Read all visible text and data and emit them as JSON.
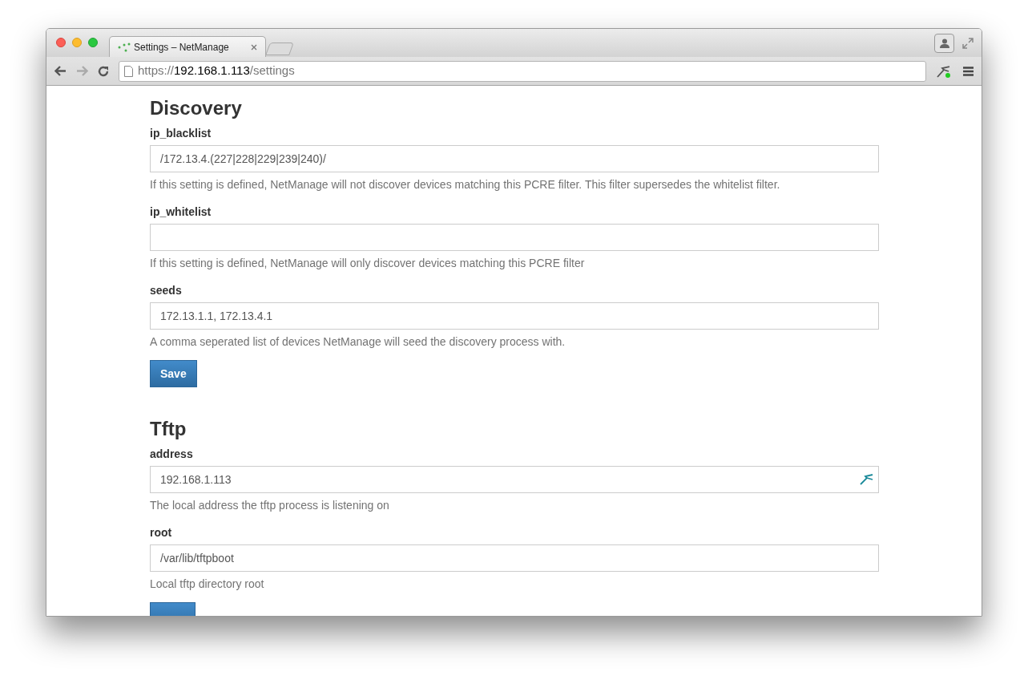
{
  "browser": {
    "tab": {
      "title": "Settings – NetManage",
      "selected": true
    },
    "address": {
      "scheme": "https://",
      "host": "192.168.1.113",
      "path": "/settings"
    }
  },
  "sections": [
    {
      "title": "Discovery",
      "fields": [
        {
          "kind": "plain",
          "label": "ip_blacklist",
          "value": "/172.13.4.(227|228|229|239|240)/",
          "help": "If this setting is defined, NetManage will not discover devices matching this PCRE filter. This filter supersedes the whitelist filter."
        },
        {
          "kind": "plain",
          "label": "ip_whitelist",
          "help": "If this setting is defined, NetManage will only discover devices matching this PCRE filter"
        },
        {
          "kind": "plain",
          "label": "seeds",
          "value": "172.13.1.1, 172.13.4.1",
          "help": "A comma seperated list of devices NetManage will seed the discovery process with."
        }
      ],
      "button": {
        "kind": "full",
        "label": "Save"
      }
    },
    {
      "title": "Tftp",
      "fields": [
        {
          "kind": "with_icon",
          "label": "address",
          "value": "192.168.1.113",
          "help": "The local address the tftp process is listening on"
        },
        {
          "kind": "plain",
          "label": "root",
          "value": "/var/lib/tftpboot",
          "help": "Local tftp directory root"
        }
      ],
      "button": {
        "kind": "clipped"
      }
    }
  ]
}
